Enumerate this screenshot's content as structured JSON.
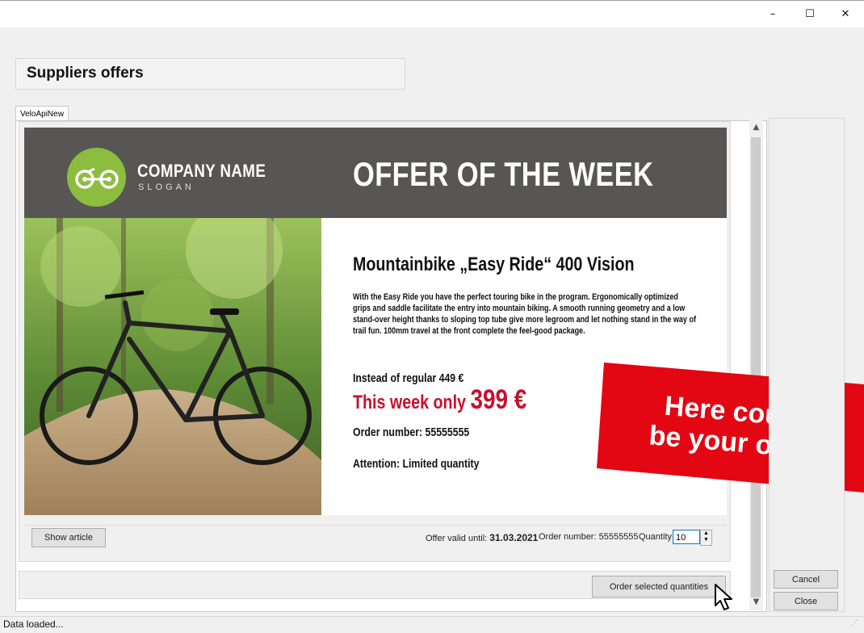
{
  "window": {
    "minimize_glyph": "–",
    "maximize_glyph": "☐",
    "close_glyph": "✕"
  },
  "header": {
    "title": "Suppliers offers"
  },
  "tabs": [
    {
      "label": "VeloApiNew",
      "active": true
    }
  ],
  "offer": {
    "company_name": "COMPANY NAME",
    "slogan": "SLOGAN",
    "banner_title": "OFFER OF THE WEEK",
    "product_title": "Mountainbike „Easy Ride“ 400 Vision",
    "description": "With the Easy Ride you have the perfect touring bike in the program. Ergonomically optimized grips and saddle facilitate the entry into mountain biking. A smooth running geometry and a low stand-over height thanks to sloping top tube give more legroom and let nothing stand in the way of trail fun. 100mm travel at the front complete the feel-good package.",
    "regular_price_text": "Instead of regular 449 €",
    "week_only_text": "This week only",
    "week_price": "399 €",
    "order_number_text": "Order number: 55555555",
    "attention_text": "Attention: Limited quantity",
    "promo_line1": "Here could",
    "promo_line2": "be your offer",
    "colors": {
      "banner_bg": "#575654",
      "logo_green": "#8cbd3e",
      "accent_red": "#c8102e",
      "promo_red": "#e30613"
    }
  },
  "infobar": {
    "show_article_label": "Show article",
    "valid_until_label": "Offer valid until:",
    "valid_until_value": "31.03.2021",
    "order_number_label": "Order number:",
    "order_number_value": "55555555",
    "quantity_label": "Quantity:",
    "quantity_value": "10"
  },
  "bottom": {
    "order_button_label": "Order selected quantities"
  },
  "side_buttons": {
    "cancel_label": "Cancel",
    "close_label": "Close"
  },
  "status": {
    "text": "Data loaded..."
  }
}
